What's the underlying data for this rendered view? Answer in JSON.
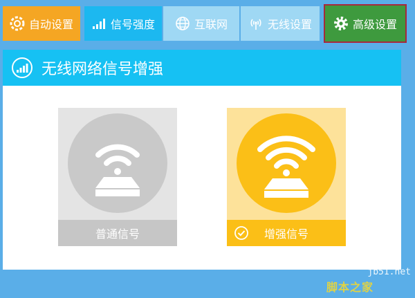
{
  "tabs": [
    {
      "label": "自动设置",
      "icon": "gear-refresh-icon"
    },
    {
      "label": "信号强度",
      "icon": "signal-bars-icon"
    },
    {
      "label": "互联网",
      "icon": "globe-icon"
    },
    {
      "label": "无线设置",
      "icon": "antenna-icon"
    },
    {
      "label": "高级设置",
      "icon": "gear-icon"
    }
  ],
  "panel": {
    "title": "无线网络信号增强",
    "icon": "signal-bars-circle-icon"
  },
  "options": [
    {
      "label": "普通信号",
      "selected": false,
      "icon": "wifi-router-icon"
    },
    {
      "label": "增强信号",
      "selected": true,
      "icon": "wifi-router-icon"
    }
  ],
  "watermark": {
    "site": "jb51.net",
    "brand": "脚本之家"
  },
  "colors": {
    "tab_auto": "#f5a623",
    "tab_active": "#1cb8f0",
    "tab_inactive": "#9fd8f4",
    "tab_advanced": "#3e9a3e",
    "header": "#16c1f3",
    "option_selected": "#fbbf17",
    "option_unselected": "#c9c9c9"
  }
}
